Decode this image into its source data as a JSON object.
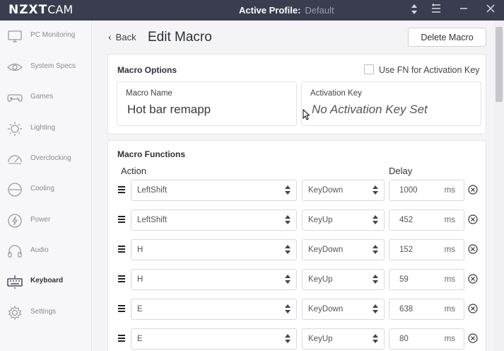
{
  "titlebar": {
    "brand": "NZXT",
    "brand_suffix": "CAM",
    "active_profile_label": "Active Profile:",
    "active_profile_value": "Default"
  },
  "sidebar": {
    "items": [
      {
        "label": "PC Monitoring",
        "icon": "monitor-icon"
      },
      {
        "label": "System Specs",
        "icon": "eye-icon"
      },
      {
        "label": "Games",
        "icon": "gamepad-icon"
      },
      {
        "label": "Lighting",
        "icon": "sun-icon"
      },
      {
        "label": "Overclocking",
        "icon": "gauge-icon"
      },
      {
        "label": "Cooling",
        "icon": "fan-icon"
      },
      {
        "label": "Power",
        "icon": "power-icon"
      },
      {
        "label": "Audio",
        "icon": "headphones-icon"
      },
      {
        "label": "Keyboard",
        "icon": "keyboard-icon",
        "active": true
      },
      {
        "label": "Settings",
        "icon": "gear-icon"
      }
    ]
  },
  "header": {
    "back_label": "Back",
    "title": "Edit Macro",
    "delete_label": "Delete Macro"
  },
  "options": {
    "title": "Macro Options",
    "fn_checkbox_label": "Use FN for Activation Key",
    "fn_checked": false,
    "macro_name_label": "Macro Name",
    "macro_name_value": "Hot bar remapp",
    "activation_key_label": "Activation Key",
    "activation_key_value": "No Activation Key Set"
  },
  "functions": {
    "title": "Macro Functions",
    "action_header": "Action",
    "delay_header": "Delay",
    "rows": [
      {
        "key": "LeftShift",
        "event": "KeyDown",
        "delay": "1000",
        "unit": "ms"
      },
      {
        "key": "LeftShift",
        "event": "KeyUp",
        "delay": "452",
        "unit": "ms"
      },
      {
        "key": "H",
        "event": "KeyDown",
        "delay": "152",
        "unit": "ms"
      },
      {
        "key": "H",
        "event": "KeyUp",
        "delay": "59",
        "unit": "ms"
      },
      {
        "key": "E",
        "event": "KeyDown",
        "delay": "638",
        "unit": "ms"
      },
      {
        "key": "E",
        "event": "KeyUp",
        "delay": "80",
        "unit": "ms"
      }
    ]
  },
  "colors": {
    "titlebar_bg": "#3a3d4e",
    "sidebar_bg": "#f7f7f9",
    "content_bg": "#f4f4f6",
    "card_bg": "#ffffff",
    "icon_gray": "#9a9aa2"
  }
}
